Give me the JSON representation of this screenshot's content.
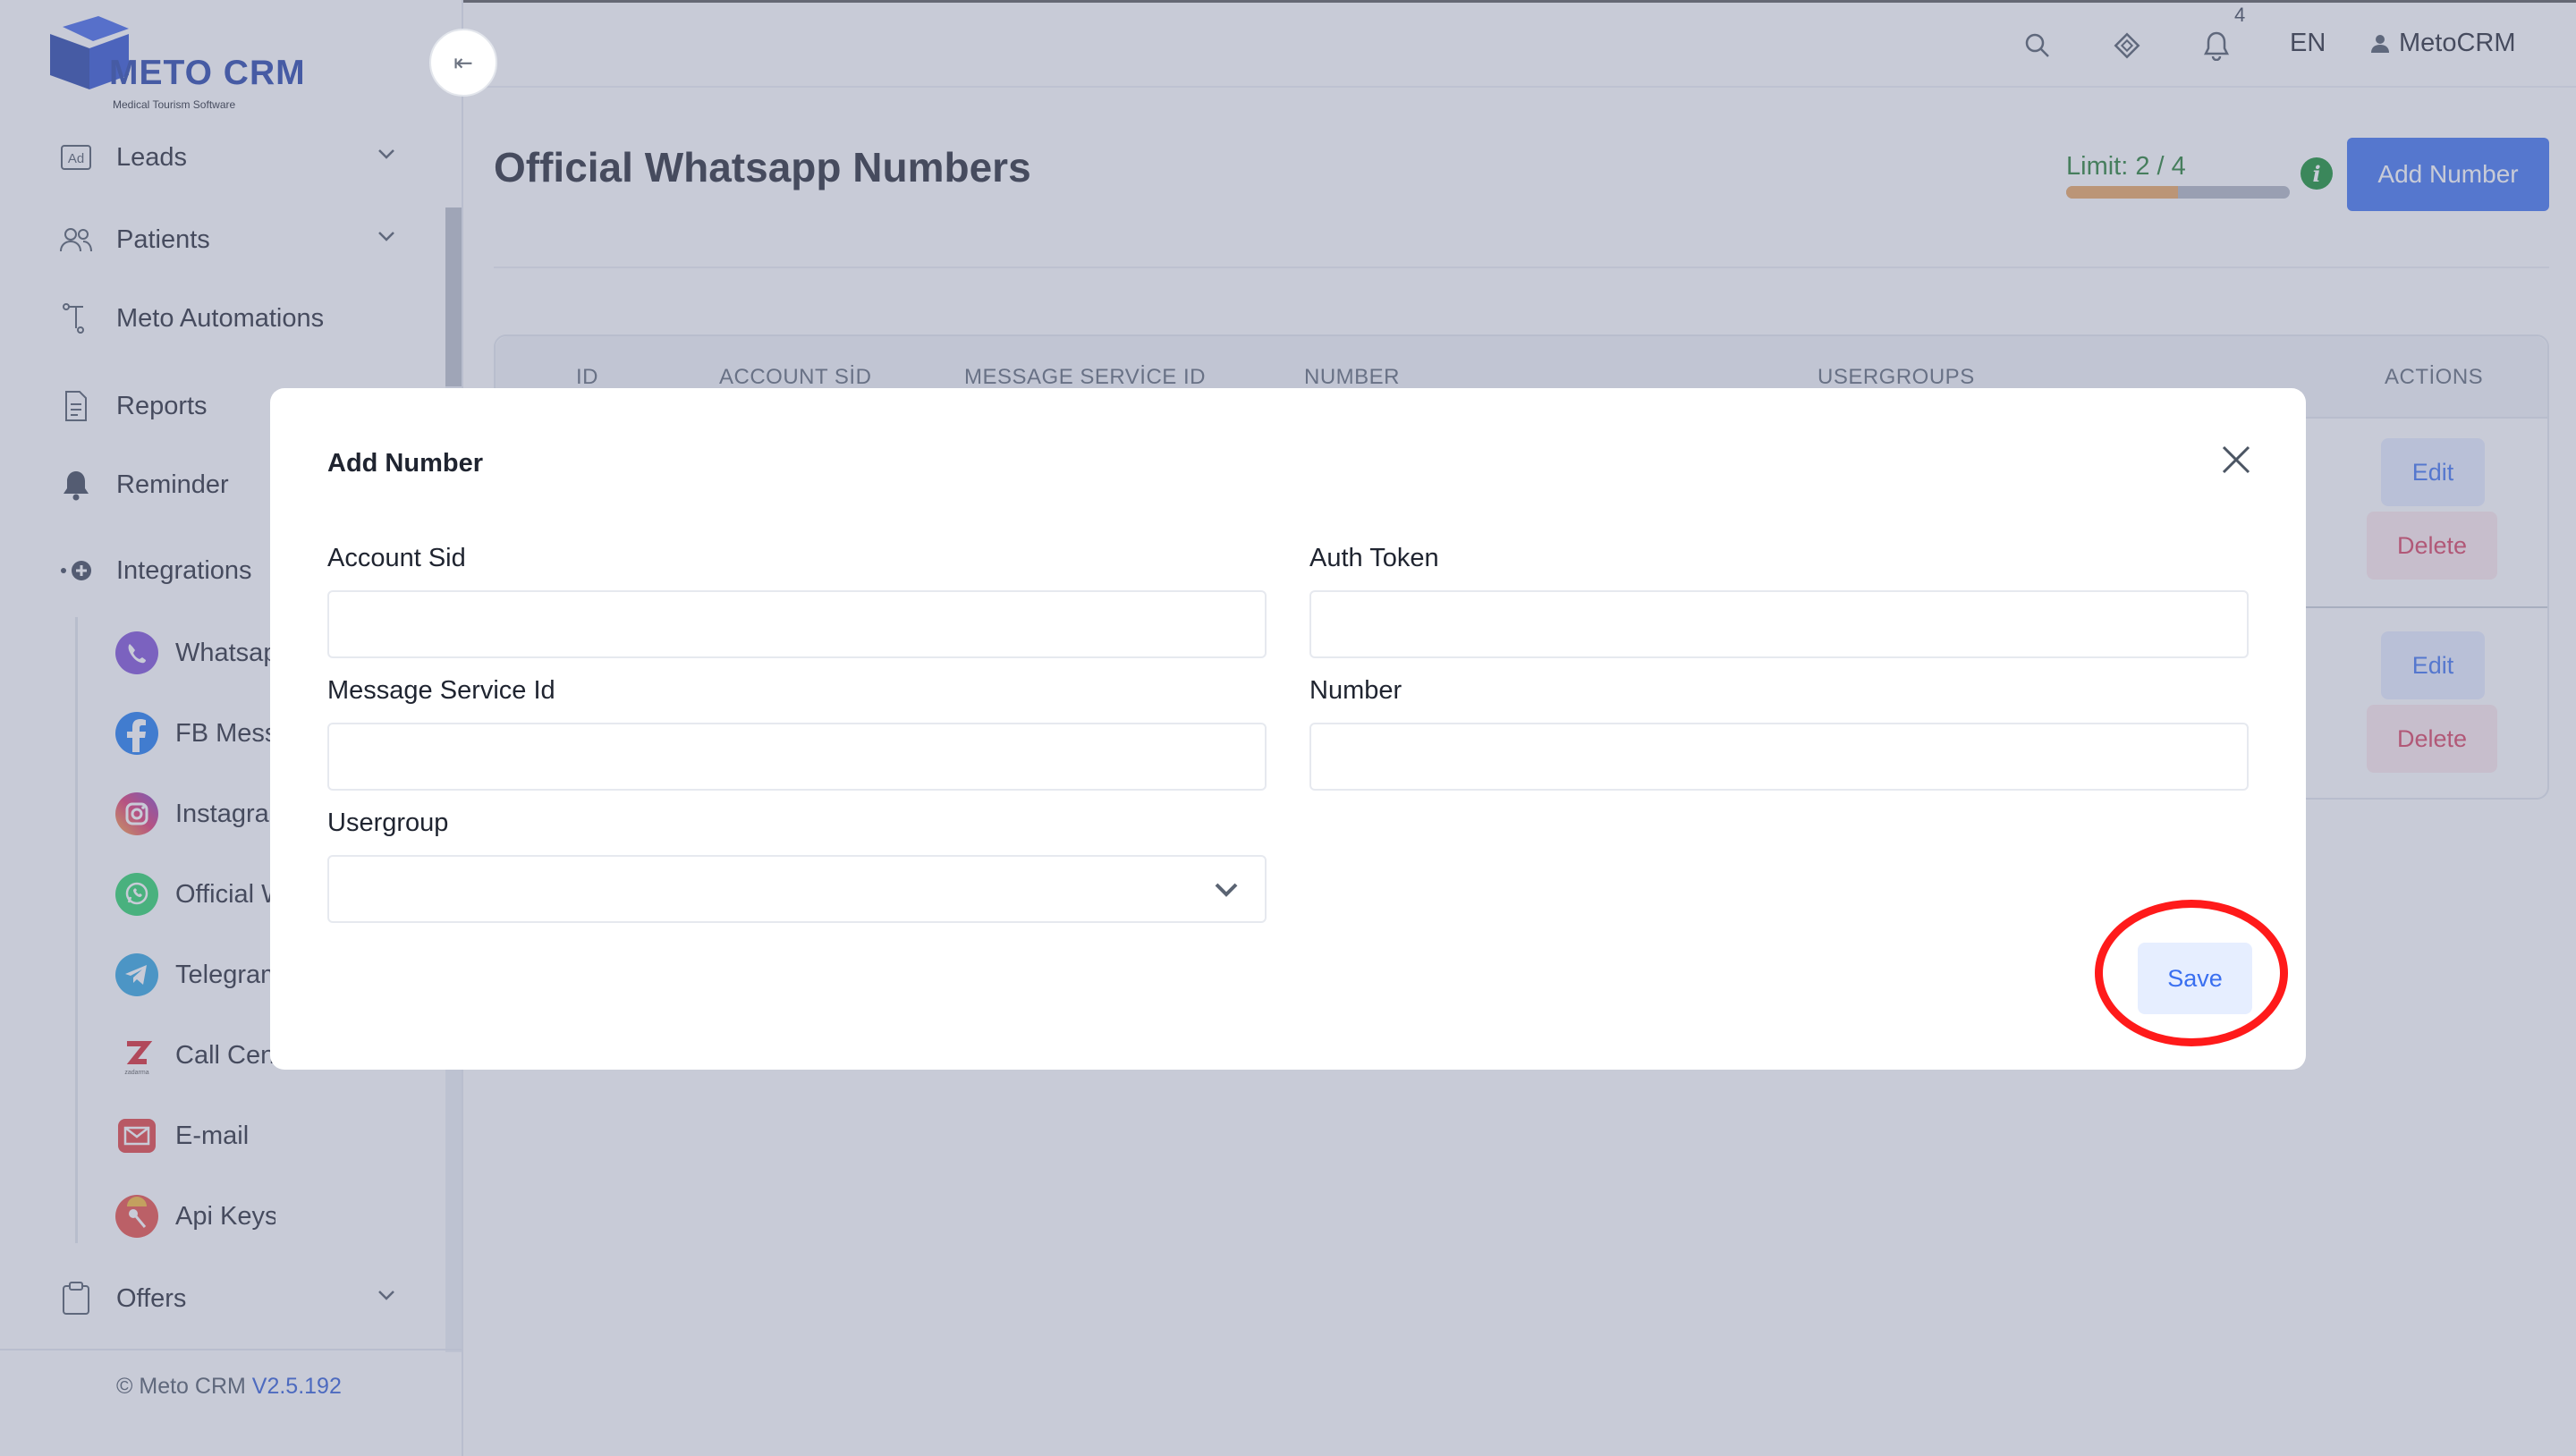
{
  "brand": {
    "name": "METO CRM",
    "tagline": "Medical Tourism Software"
  },
  "sidebar": {
    "collapse_glyph": "⇤",
    "items": [
      {
        "label": "Leads"
      },
      {
        "label": "Patients"
      },
      {
        "label": "Meto Automations"
      },
      {
        "label": "Reports"
      },
      {
        "label": "Reminder"
      },
      {
        "label": "Integrations"
      }
    ],
    "subitems": [
      {
        "label": "Whatsapp"
      },
      {
        "label": "FB Messenger"
      },
      {
        "label": "Instagram"
      },
      {
        "label": "Official Whatsapp"
      },
      {
        "label": "Telegram"
      },
      {
        "label": "Call Center"
      },
      {
        "label": "E-mail"
      },
      {
        "label": "Api Keys"
      }
    ],
    "offers": {
      "label": "Offers"
    },
    "footer": {
      "copyright": "© Meto CRM",
      "version": "V2.5.192"
    }
  },
  "header": {
    "notification_count": "4",
    "language": "EN",
    "user": "MetoCRM"
  },
  "page": {
    "title": "Official Whatsapp Numbers",
    "limit_label": "Limit: 2 / 4",
    "limit_fraction": 0.5,
    "info_glyph": "i",
    "add_button": "Add Number"
  },
  "table": {
    "columns": [
      "ID",
      "ACCOUNT SİD",
      "MESSAGE SERVİCE ID",
      "NUMBER",
      "USERGROUPS",
      "ACTİONS"
    ],
    "rows": [
      {
        "edit": "Edit",
        "delete": "Delete"
      },
      {
        "edit": "Edit",
        "delete": "Delete"
      }
    ]
  },
  "modal": {
    "title": "Add Number",
    "fields": {
      "account_sid": {
        "label": "Account Sid",
        "value": ""
      },
      "auth_token": {
        "label": "Auth Token",
        "value": ""
      },
      "message_service_id": {
        "label": "Message Service Id",
        "value": ""
      },
      "number": {
        "label": "Number",
        "value": ""
      },
      "usergroup": {
        "label": "Usergroup",
        "value": ""
      }
    },
    "save_label": "Save"
  },
  "colors": {
    "primary": "#3a6ff0",
    "brand": "#1f3ea8",
    "limit_text": "#1f7a2e",
    "delete": "#d83a5a",
    "highlight_ring": "#ff1a1a"
  },
  "icons": {
    "leads": "ad-icon",
    "patients": "users-icon",
    "automations": "flow-icon",
    "reports": "document-icon",
    "reminder": "bell-icon",
    "integrations": "plug-icon",
    "offers": "clipboard-icon",
    "search": "search-icon",
    "status": "diamond-icon",
    "notifications": "bell-icon",
    "user": "user-icon",
    "close": "close-icon"
  }
}
